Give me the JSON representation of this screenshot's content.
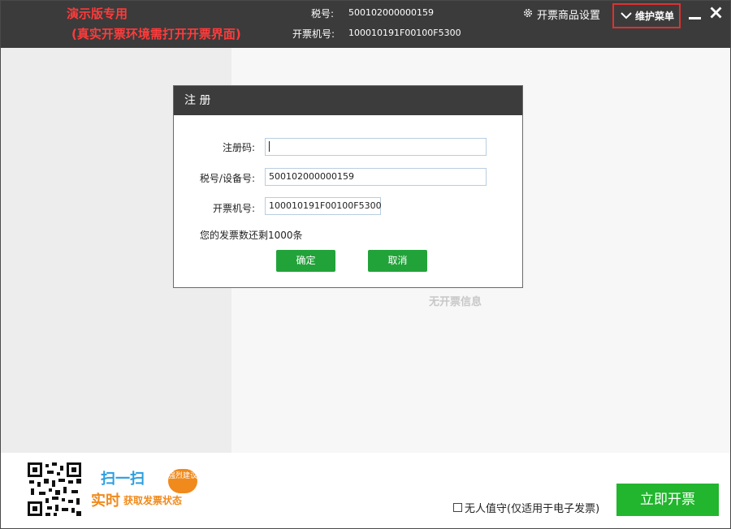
{
  "header": {
    "demo_line1": "演示版专用",
    "demo_line2": "(真实开票环境需打开开票界面)",
    "tax_label": "税号:",
    "tax_value": "500102000000159",
    "machine_label": "开票机号:",
    "machine_value": "100010191F00100F5300",
    "settings_label": "开票商品设置",
    "maintenance_label": "维护菜单"
  },
  "main": {
    "empty_text": "无开票信息"
  },
  "dialog": {
    "title": "注 册",
    "reg_code_label": "注册码:",
    "reg_code_value": "",
    "tax_device_label": "税号/设备号:",
    "tax_device_value": "500102000000159",
    "machine_label": "开票机号:",
    "machine_value": "100010191F00100F5300",
    "remaining_text": "您的发票数还剩1000条",
    "confirm_label": "确定",
    "cancel_label": "取消"
  },
  "footer": {
    "promo_line1": "扫一扫",
    "promo_badge": "强烈建议",
    "promo_line2": "实时",
    "promo_line3": "获取发票状态",
    "unattended_label": "无人值守(仅适用于电子发票)",
    "unattended_checked": false,
    "issue_button": "立即开票"
  },
  "colors": {
    "accent_green": "#22b52e",
    "demo_red": "#ff3b3b",
    "header_bg": "#3b3b3b"
  }
}
